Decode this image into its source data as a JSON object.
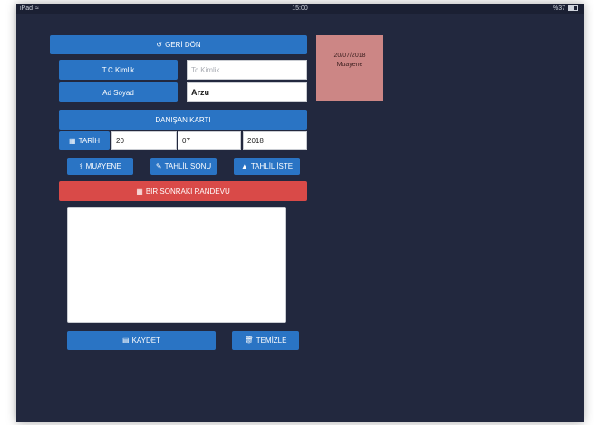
{
  "status_bar": {
    "device": "iPad",
    "time": "15:00",
    "battery": "%37"
  },
  "header": {
    "back_label": "GERİ DÖN",
    "back_icon": "refresh-back-icon"
  },
  "form": {
    "tc_label": "T.C Kimlik",
    "tc_placeholder": "Tc Kimlik",
    "name_label": "Ad Soyad",
    "name_value": "Arzu"
  },
  "card": {
    "title": "DANIŞAN KARTI"
  },
  "date": {
    "label": "TARİH",
    "day": "20",
    "month": "07",
    "year": "2018"
  },
  "actions": {
    "muayene": "MUAYENE",
    "tahlil_sonu": "TAHLİL SONU",
    "tahlil_iste": "TAHLİL İSTE"
  },
  "next_appointment": {
    "label": "BİR SONRAKİ RANDEVU"
  },
  "notes": {
    "value": ""
  },
  "footer": {
    "save": "KAYDET",
    "clear": "TEMİZLE"
  },
  "sidebar_note": {
    "date": "20/07/2018",
    "type": "Muayene"
  },
  "colors": {
    "background": "#22283e",
    "primary": "#2a74c4",
    "danger": "#d94a48",
    "note_card": "#cc8685"
  }
}
